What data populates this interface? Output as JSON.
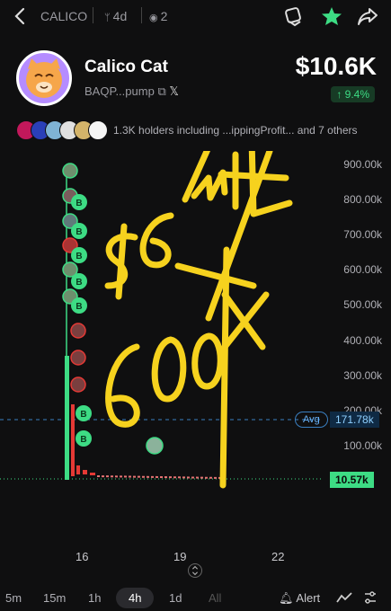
{
  "header": {
    "ticker": "CALICO",
    "age": "4d",
    "views": "2"
  },
  "token": {
    "name": "Calico Cat",
    "address": "BAQP...pump",
    "price": "$10.6K",
    "change": "↑ 9.4%"
  },
  "holders": {
    "text": "1.3K holders including ...ippingProfit... and 7 others"
  },
  "chart": {
    "y_ticks": [
      "900.00k",
      "800.00k",
      "700.00k",
      "600.00k",
      "500.00k",
      "400.00k",
      "300.00k",
      "200.00k",
      "100.00k"
    ],
    "x_ticks": [
      "16",
      "19",
      "22"
    ],
    "avg_label": "Avg",
    "avg_value": "171.78k",
    "current_value": "10.57k",
    "buy_marker": "B"
  },
  "timeframes": [
    "5m",
    "15m",
    "1h",
    "4h",
    "1d",
    "All"
  ],
  "active_timeframe": "4h",
  "toolbar": {
    "alert_label": "Alert"
  },
  "annotation": {
    "text1": "$6 mil",
    "text2": "600x"
  }
}
